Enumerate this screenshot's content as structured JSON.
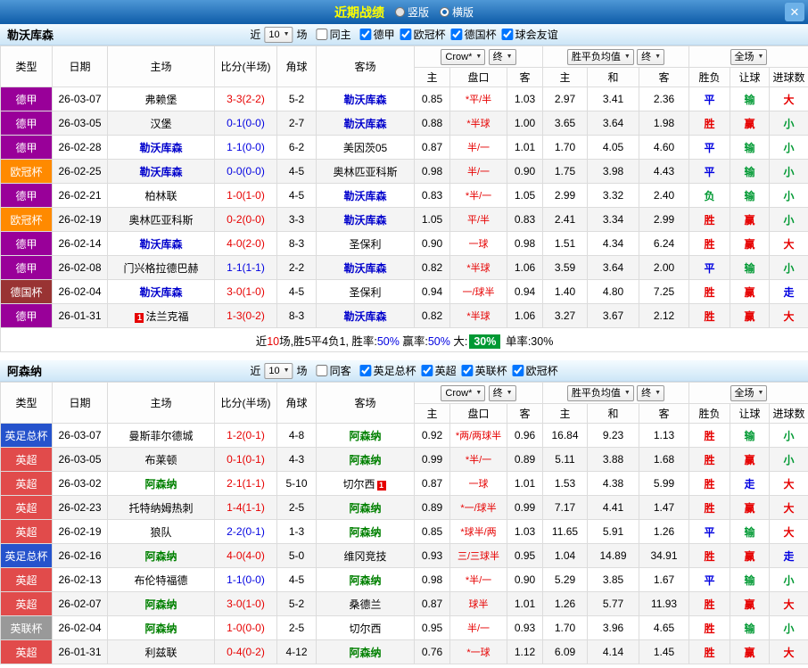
{
  "palette": {
    "red": "#e60000",
    "blue": "#0000e0",
    "green": "#009933"
  },
  "type_colors": {
    "德甲": "#990099",
    "欧冠杯": "#ff8a00",
    "德国杯": "#993333",
    "英足总杯": "#2653cc",
    "英超": "#e14b4b",
    "英联杯": "#999999"
  },
  "titlebar": {
    "title": "近期战绩",
    "options": [
      {
        "label": "竖版",
        "selected": false
      },
      {
        "label": "横版",
        "selected": true
      }
    ],
    "close_icon": "✕"
  },
  "filter_labels": {
    "recent": "近",
    "count": "10",
    "games": "场"
  },
  "table_header": {
    "type": "类型",
    "date": "日期",
    "home": "主场",
    "score": "比分(半场)",
    "corner": "角球",
    "away": "客场",
    "odds_home": "主",
    "handicap": "盘口",
    "odds_away": "客",
    "eu_home": "主",
    "eu_draw": "和",
    "eu_away": "客",
    "wdl": "胜负",
    "let": "让球",
    "goals": "进球数",
    "bookmaker": "Crow*",
    "final": "终",
    "avg": "胜平负均值",
    "scope": "全场"
  },
  "sections": [
    {
      "team": "勒沃库森",
      "team_color": "#0000cc",
      "same_label": "同主",
      "same_checked": false,
      "leagues": [
        "德甲",
        "欧冠杯",
        "德国杯",
        "球会友谊"
      ],
      "rows": [
        {
          "league": "德甲",
          "date": "26-03-07",
          "home": "弗赖堡",
          "score": "3-3(2-2)",
          "score_color": "red",
          "corner": "5-2",
          "away": "勒沃库森",
          "asia": [
            "0.85",
            "*平/半",
            "1.03"
          ],
          "europe": [
            "2.97",
            "3.41",
            "2.36"
          ],
          "results": [
            {
              "t": "平",
              "c": "blue"
            },
            {
              "t": "输",
              "c": "green"
            },
            {
              "t": "大",
              "c": "red"
            }
          ]
        },
        {
          "league": "德甲",
          "date": "26-03-05",
          "home": "汉堡",
          "score": "0-1(0-0)",
          "score_color": "blue",
          "corner": "2-7",
          "away": "勒沃库森",
          "asia": [
            "0.88",
            "*半球",
            "1.00"
          ],
          "europe": [
            "3.65",
            "3.64",
            "1.98"
          ],
          "results": [
            {
              "t": "胜",
              "c": "red"
            },
            {
              "t": "赢",
              "c": "red"
            },
            {
              "t": "小",
              "c": "green"
            }
          ]
        },
        {
          "league": "德甲",
          "date": "26-02-28",
          "home": "勒沃库森",
          "score": "1-1(0-0)",
          "score_color": "blue",
          "corner": "6-2",
          "away": "美因茨05",
          "asia": [
            "0.87",
            "半/一",
            "1.01"
          ],
          "europe": [
            "1.70",
            "4.05",
            "4.60"
          ],
          "results": [
            {
              "t": "平",
              "c": "blue"
            },
            {
              "t": "输",
              "c": "green"
            },
            {
              "t": "小",
              "c": "green"
            }
          ]
        },
        {
          "league": "欧冠杯",
          "date": "26-02-25",
          "home": "勒沃库森",
          "score": "0-0(0-0)",
          "score_color": "blue",
          "corner": "4-5",
          "away": "奥林匹亚科斯",
          "asia": [
            "0.98",
            "半/一",
            "0.90"
          ],
          "europe": [
            "1.75",
            "3.98",
            "4.43"
          ],
          "results": [
            {
              "t": "平",
              "c": "blue"
            },
            {
              "t": "输",
              "c": "green"
            },
            {
              "t": "小",
              "c": "green"
            }
          ]
        },
        {
          "league": "德甲",
          "date": "26-02-21",
          "home": "柏林联",
          "score": "1-0(1-0)",
          "score_color": "red",
          "corner": "4-5",
          "away": "勒沃库森",
          "asia": [
            "0.83",
            "*半/一",
            "1.05"
          ],
          "europe": [
            "2.99",
            "3.32",
            "2.40"
          ],
          "results": [
            {
              "t": "负",
              "c": "green"
            },
            {
              "t": "输",
              "c": "green"
            },
            {
              "t": "小",
              "c": "green"
            }
          ]
        },
        {
          "league": "欧冠杯",
          "date": "26-02-19",
          "home": "奥林匹亚科斯",
          "score": "0-2(0-0)",
          "score_color": "red",
          "corner": "3-3",
          "away": "勒沃库森",
          "asia": [
            "1.05",
            "平/半",
            "0.83"
          ],
          "europe": [
            "2.41",
            "3.34",
            "2.99"
          ],
          "results": [
            {
              "t": "胜",
              "c": "red"
            },
            {
              "t": "赢",
              "c": "red"
            },
            {
              "t": "小",
              "c": "green"
            }
          ]
        },
        {
          "league": "德甲",
          "date": "26-02-14",
          "home": "勒沃库森",
          "score": "4-0(2-0)",
          "score_color": "red",
          "corner": "8-3",
          "away": "圣保利",
          "asia": [
            "0.90",
            "一球",
            "0.98"
          ],
          "europe": [
            "1.51",
            "4.34",
            "6.24"
          ],
          "results": [
            {
              "t": "胜",
              "c": "red"
            },
            {
              "t": "赢",
              "c": "red"
            },
            {
              "t": "大",
              "c": "red"
            }
          ]
        },
        {
          "league": "德甲",
          "date": "26-02-08",
          "home": "门兴格拉德巴赫",
          "score": "1-1(1-1)",
          "score_color": "blue",
          "corner": "2-2",
          "away": "勒沃库森",
          "asia": [
            "0.82",
            "*半球",
            "1.06"
          ],
          "europe": [
            "3.59",
            "3.64",
            "2.00"
          ],
          "results": [
            {
              "t": "平",
              "c": "blue"
            },
            {
              "t": "输",
              "c": "green"
            },
            {
              "t": "小",
              "c": "green"
            }
          ]
        },
        {
          "league": "德国杯",
          "date": "26-02-04",
          "home": "勒沃库森",
          "score": "3-0(1-0)",
          "score_color": "red",
          "corner": "4-5",
          "away": "圣保利",
          "asia": [
            "0.94",
            "一/球半",
            "0.94"
          ],
          "europe": [
            "1.40",
            "4.80",
            "7.25"
          ],
          "results": [
            {
              "t": "胜",
              "c": "red"
            },
            {
              "t": "赢",
              "c": "red"
            },
            {
              "t": "走",
              "c": "blue"
            }
          ]
        },
        {
          "league": "德甲",
          "date": "26-01-31",
          "home": "法兰克福",
          "home_card": "1",
          "score": "1-3(0-2)",
          "score_color": "red",
          "corner": "8-3",
          "away": "勒沃库森",
          "asia": [
            "0.82",
            "*半球",
            "1.06"
          ],
          "europe": [
            "3.27",
            "3.67",
            "2.12"
          ],
          "results": [
            {
              "t": "胜",
              "c": "red"
            },
            {
              "t": "赢",
              "c": "red"
            },
            {
              "t": "大",
              "c": "red"
            }
          ]
        }
      ],
      "summary": [
        {
          "text": "近"
        },
        {
          "text": "10",
          "color": "red"
        },
        {
          "text": "场,胜5平4负1, 胜率:"
        },
        {
          "text": "50%",
          "color": "blue"
        },
        {
          "text": " 赢率:"
        },
        {
          "text": "50%",
          "color": "blue"
        },
        {
          "text": " 大:"
        },
        {
          "text": "30%",
          "badge": true
        },
        {
          "text": " 单率:30%"
        }
      ]
    },
    {
      "team": "阿森纳",
      "team_color": "#008000",
      "same_label": "同客",
      "same_checked": false,
      "leagues": [
        "英足总杯",
        "英超",
        "英联杯",
        "欧冠杯"
      ],
      "rows": [
        {
          "league": "英足总杯",
          "date": "26-03-07",
          "home": "曼斯菲尔德城",
          "score": "1-2(0-1)",
          "score_color": "red",
          "corner": "4-8",
          "away": "阿森纳",
          "asia": [
            "0.92",
            "*两/两球半",
            "0.96"
          ],
          "europe": [
            "16.84",
            "9.23",
            "1.13"
          ],
          "results": [
            {
              "t": "胜",
              "c": "red"
            },
            {
              "t": "输",
              "c": "green"
            },
            {
              "t": "小",
              "c": "green"
            }
          ]
        },
        {
          "league": "英超",
          "date": "26-03-05",
          "home": "布莱顿",
          "score": "0-1(0-1)",
          "score_color": "red",
          "corner": "4-3",
          "away": "阿森纳",
          "asia": [
            "0.99",
            "*半/一",
            "0.89"
          ],
          "europe": [
            "5.11",
            "3.88",
            "1.68"
          ],
          "results": [
            {
              "t": "胜",
              "c": "red"
            },
            {
              "t": "赢",
              "c": "red"
            },
            {
              "t": "小",
              "c": "green"
            }
          ]
        },
        {
          "league": "英超",
          "date": "26-03-02",
          "home": "阿森纳",
          "score": "2-1(1-1)",
          "score_color": "red",
          "corner": "5-10",
          "away": "切尔西",
          "away_card": "1",
          "asia": [
            "0.87",
            "一球",
            "1.01"
          ],
          "europe": [
            "1.53",
            "4.38",
            "5.99"
          ],
          "results": [
            {
              "t": "胜",
              "c": "red"
            },
            {
              "t": "走",
              "c": "blue"
            },
            {
              "t": "大",
              "c": "red"
            }
          ]
        },
        {
          "league": "英超",
          "date": "26-02-23",
          "home": "托特纳姆热刺",
          "score": "1-4(1-1)",
          "score_color": "red",
          "corner": "2-5",
          "away": "阿森纳",
          "asia": [
            "0.89",
            "*一/球半",
            "0.99"
          ],
          "europe": [
            "7.17",
            "4.41",
            "1.47"
          ],
          "results": [
            {
              "t": "胜",
              "c": "red"
            },
            {
              "t": "赢",
              "c": "red"
            },
            {
              "t": "大",
              "c": "red"
            }
          ]
        },
        {
          "league": "英超",
          "date": "26-02-19",
          "home": "狼队",
          "score": "2-2(0-1)",
          "score_color": "blue",
          "corner": "1-3",
          "away": "阿森纳",
          "asia": [
            "0.85",
            "*球半/两",
            "1.03"
          ],
          "europe": [
            "11.65",
            "5.91",
            "1.26"
          ],
          "results": [
            {
              "t": "平",
              "c": "blue"
            },
            {
              "t": "输",
              "c": "green"
            },
            {
              "t": "大",
              "c": "red"
            }
          ]
        },
        {
          "league": "英足总杯",
          "date": "26-02-16",
          "home": "阿森纳",
          "score": "4-0(4-0)",
          "score_color": "red",
          "corner": "5-0",
          "away": "维冈竞技",
          "asia": [
            "0.93",
            "三/三球半",
            "0.95"
          ],
          "europe": [
            "1.04",
            "14.89",
            "34.91"
          ],
          "results": [
            {
              "t": "胜",
              "c": "red"
            },
            {
              "t": "赢",
              "c": "red"
            },
            {
              "t": "走",
              "c": "blue"
            }
          ]
        },
        {
          "league": "英超",
          "date": "26-02-13",
          "home": "布伦特福德",
          "score": "1-1(0-0)",
          "score_color": "blue",
          "corner": "4-5",
          "away": "阿森纳",
          "asia": [
            "0.98",
            "*半/一",
            "0.90"
          ],
          "europe": [
            "5.29",
            "3.85",
            "1.67"
          ],
          "results": [
            {
              "t": "平",
              "c": "blue"
            },
            {
              "t": "输",
              "c": "green"
            },
            {
              "t": "小",
              "c": "green"
            }
          ]
        },
        {
          "league": "英超",
          "date": "26-02-07",
          "home": "阿森纳",
          "score": "3-0(1-0)",
          "score_color": "red",
          "corner": "5-2",
          "away": "桑德兰",
          "asia": [
            "0.87",
            "球半",
            "1.01"
          ],
          "europe": [
            "1.26",
            "5.77",
            "11.93"
          ],
          "results": [
            {
              "t": "胜",
              "c": "red"
            },
            {
              "t": "赢",
              "c": "red"
            },
            {
              "t": "大",
              "c": "red"
            }
          ]
        },
        {
          "league": "英联杯",
          "date": "26-02-04",
          "home": "阿森纳",
          "score": "1-0(0-0)",
          "score_color": "red",
          "corner": "2-5",
          "away": "切尔西",
          "asia": [
            "0.95",
            "半/一",
            "0.93"
          ],
          "europe": [
            "1.70",
            "3.96",
            "4.65"
          ],
          "results": [
            {
              "t": "胜",
              "c": "red"
            },
            {
              "t": "输",
              "c": "green"
            },
            {
              "t": "小",
              "c": "green"
            }
          ]
        },
        {
          "league": "英超",
          "date": "26-01-31",
          "home": "利兹联",
          "score": "0-4(0-2)",
          "score_color": "red",
          "corner": "4-12",
          "away": "阿森纳",
          "asia": [
            "0.76",
            "*一球",
            "1.12"
          ],
          "europe": [
            "6.09",
            "4.14",
            "1.45"
          ],
          "results": [
            {
              "t": "胜",
              "c": "red"
            },
            {
              "t": "赢",
              "c": "red"
            },
            {
              "t": "大",
              "c": "red"
            }
          ]
        }
      ],
      "summary": null
    }
  ]
}
